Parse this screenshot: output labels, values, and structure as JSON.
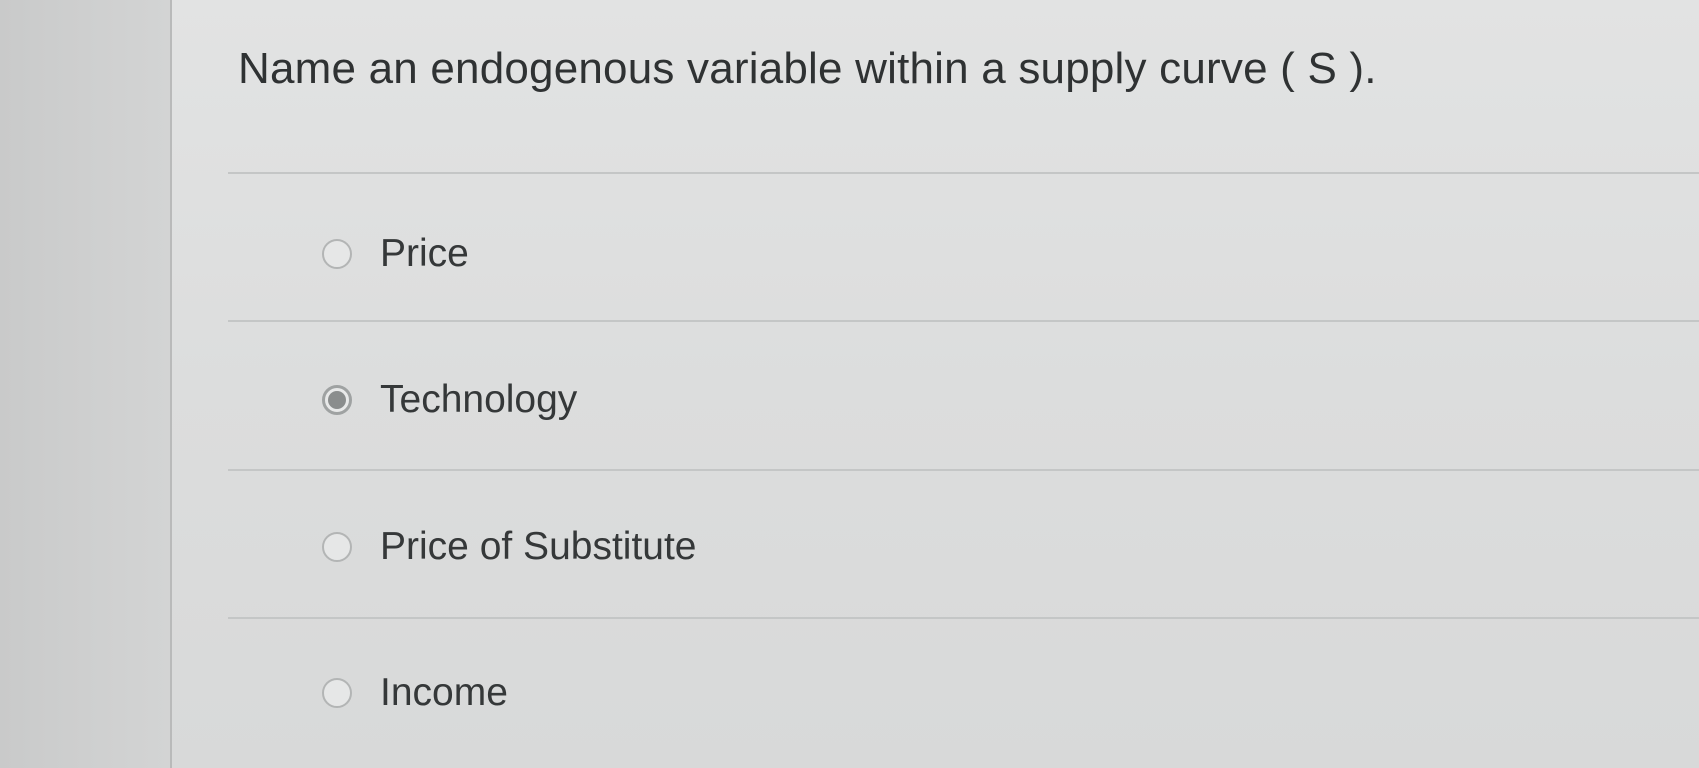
{
  "question": {
    "text": "Name an endogenous variable within a supply curve ( S )."
  },
  "answers": [
    {
      "label": "Price",
      "selected": false
    },
    {
      "label": "Technology",
      "selected": true
    },
    {
      "label": "Price of Substitute",
      "selected": false
    },
    {
      "label": "Income",
      "selected": false
    }
  ],
  "colors": {
    "background": "#cfd0d0",
    "panel": "#dfe0e0",
    "text": "#2f3233",
    "divider": "#c4c6c6",
    "radio_selected": "#8a8d8d"
  }
}
